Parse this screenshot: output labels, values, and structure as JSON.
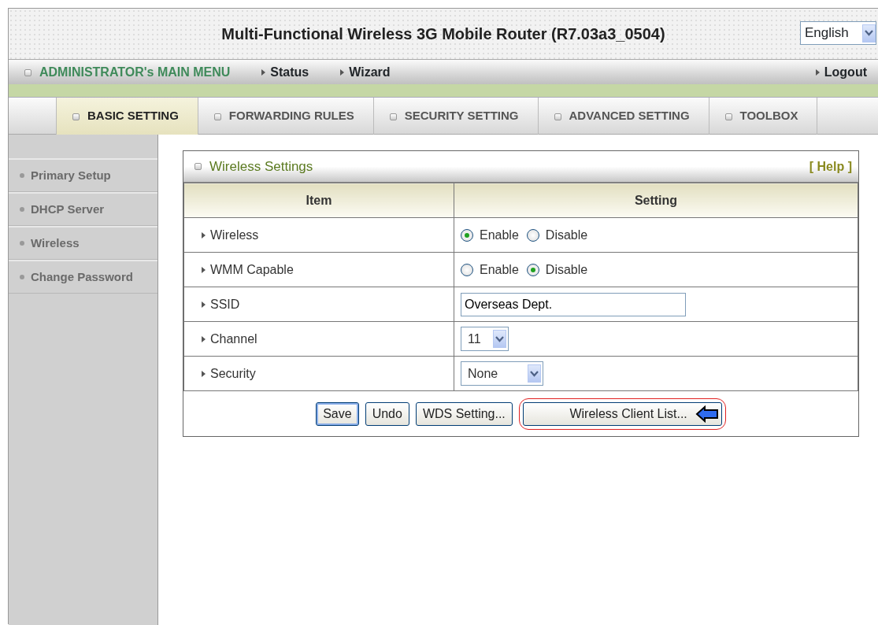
{
  "header": {
    "title": "Multi-Functional Wireless 3G Mobile Router (R7.03a3_0504)",
    "language": "English"
  },
  "main_menu": {
    "title": "ADMINISTRATOR's MAIN MENU",
    "links": [
      "Status",
      "Wizard"
    ],
    "logout": "Logout"
  },
  "tabs": [
    {
      "label": "BASIC SETTING",
      "selected": true
    },
    {
      "label": "FORWARDING RULES",
      "selected": false
    },
    {
      "label": "SECURITY SETTING",
      "selected": false
    },
    {
      "label": "ADVANCED SETTING",
      "selected": false
    },
    {
      "label": "TOOLBOX",
      "selected": false
    }
  ],
  "sidebar": {
    "items": [
      "Primary Setup",
      "DHCP Server",
      "Wireless",
      "Change Password"
    ]
  },
  "panel": {
    "title": "Wireless Settings",
    "help": "[ Help ]",
    "columns": [
      "Item",
      "Setting"
    ],
    "rows": [
      {
        "kind": "radio",
        "label": "Wireless",
        "options": [
          {
            "label": "Enable",
            "selected": true
          },
          {
            "label": "Disable",
            "selected": false
          }
        ]
      },
      {
        "kind": "radio",
        "label": "WMM Capable",
        "options": [
          {
            "label": "Enable",
            "selected": false
          },
          {
            "label": "Disable",
            "selected": true
          }
        ]
      },
      {
        "kind": "text",
        "label": "SSID",
        "value": "Overseas Dept."
      },
      {
        "kind": "select",
        "label": "Channel",
        "value": "11"
      },
      {
        "kind": "select",
        "label": "Security",
        "value": "None"
      }
    ],
    "buttons": [
      {
        "label": "Save",
        "focused": true,
        "annotated": false
      },
      {
        "label": "Undo",
        "focused": false,
        "annotated": false
      },
      {
        "label": "WDS Setting...",
        "focused": false,
        "annotated": false
      },
      {
        "label": "Wireless Client List...",
        "focused": false,
        "annotated": true
      }
    ]
  }
}
